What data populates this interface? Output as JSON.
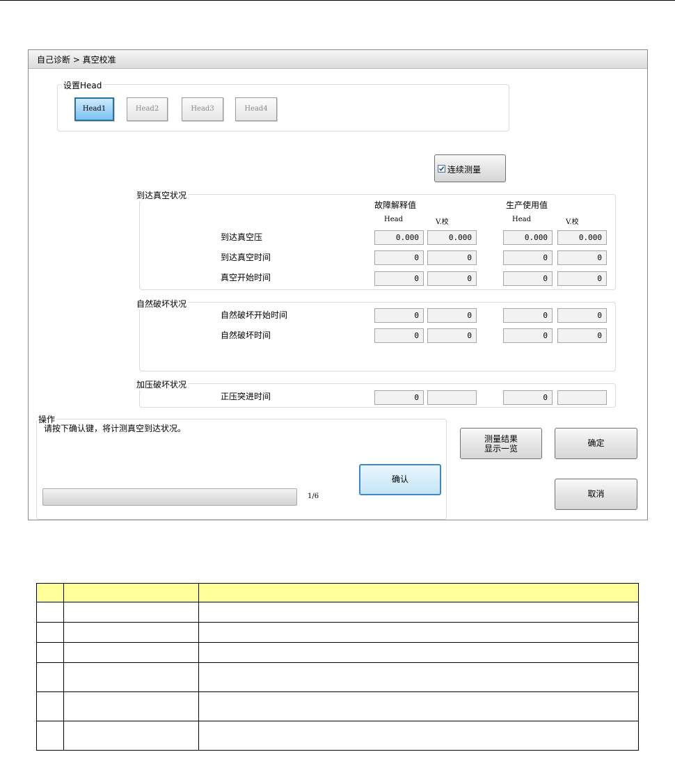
{
  "window": {
    "title": "自己诊断 > 真空校准"
  },
  "head_group": {
    "label": "设置Head",
    "buttons": [
      "Head1",
      "Head2",
      "Head3",
      "Head4"
    ],
    "active": "Head1"
  },
  "continuous": {
    "label": "连续测量",
    "checked": true
  },
  "table": {
    "col_group_1": "故障解释值",
    "col_group_2": "生产使用值",
    "sub_head": "Head",
    "sub_v": "V.校"
  },
  "sections": [
    {
      "label": "到达真空状况",
      "rows": [
        {
          "label": "到达真空压",
          "values": [
            "0.000",
            "0.000",
            "0.000",
            "0.000"
          ]
        },
        {
          "label": "到达真空时间",
          "values": [
            "0",
            "0",
            "0",
            "0"
          ]
        },
        {
          "label": "真空开始时间",
          "values": [
            "0",
            "0",
            "0",
            "0"
          ]
        }
      ]
    },
    {
      "label": "自然破坏状况",
      "rows": [
        {
          "label": "自然破坏开始时间",
          "values": [
            "0",
            "0",
            "0",
            "0"
          ]
        },
        {
          "label": "自然破坏时间",
          "values": [
            "0",
            "0",
            "0",
            "0"
          ]
        }
      ]
    },
    {
      "label": "加压破坏状况",
      "rows": [
        {
          "label": "正压突进时间",
          "values": [
            "0",
            "",
            "0",
            ""
          ]
        }
      ]
    }
  ],
  "operation": {
    "label": "操作",
    "message": "请按下确认键，将计测真空到达状况。",
    "confirm_button": "确认",
    "progress_text": "1/6",
    "progress": 0
  },
  "buttons": {
    "results_line1": "测量结果",
    "results_line2": "显示一览",
    "ok": "确定",
    "cancel": "取消"
  },
  "colors": {
    "header_fill": "#ffff99",
    "active_head": "#7cc2f0"
  },
  "icons": {
    "checkbox": "checkbox-checked-icon"
  }
}
